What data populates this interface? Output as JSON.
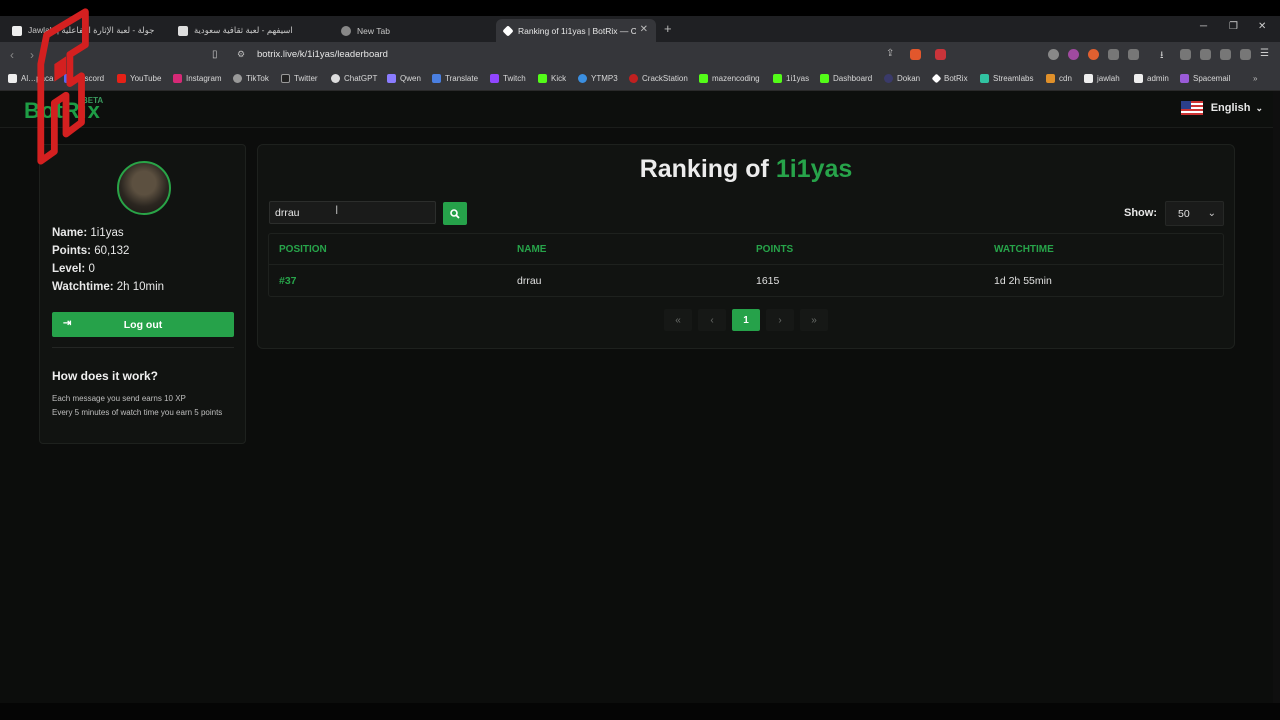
{
  "browser": {
    "tabs": [
      {
        "title": "Jawlah | جولة - لعبة الإثارة التفاعلية",
        "left": 0
      },
      {
        "title": "اسيفهم - لعبة ثقافية سعودية"
      },
      {
        "title": "New Tab"
      },
      {
        "title": "Ranking of 1i1yas | BotRix — Cl…",
        "active": true
      }
    ],
    "url": "botrix.live/k/1i1yas/leaderboard",
    "bookmarks": [
      "Al…paca",
      "Discord",
      "YouTube",
      "Instagram",
      "TikTok",
      "Twitter",
      "ChatGPT",
      "Qwen",
      "Translate",
      "Twitch",
      "Kick",
      "YTMP3",
      "CrackStation",
      "mazencoding",
      "1i1yas",
      "Dashboard",
      "Dokan",
      "BotRix",
      "Streamlabs",
      "cdn",
      "jawlah",
      "admin",
      "Spacemail"
    ]
  },
  "header": {
    "logo": "BotRix",
    "beta": "BETA",
    "language": "English"
  },
  "profile": {
    "name_label": "Name:",
    "name": "1i1yas",
    "points_label": "Points:",
    "points": "60,132",
    "level_label": "Level:",
    "level": "0",
    "watchtime_label": "Watchtime:",
    "watchtime": "2h 10min",
    "logout": "Log out",
    "how_title": "How does it work?",
    "how_line1": "Each message you send earns 10 XP",
    "how_line2": "Every 5 minutes of watch time you earn 5 points"
  },
  "leaderboard": {
    "title_prefix": "Ranking of",
    "title_user": "1i1yas",
    "search_value": "drrau",
    "show_label": "Show:",
    "show_value": "50",
    "columns": [
      "POSITION",
      "NAME",
      "POINTS",
      "WATCHTIME"
    ],
    "rows": [
      {
        "position": "#37",
        "name": "drrau",
        "points": "1615",
        "watchtime": "1d 2h 55min"
      }
    ],
    "pagination": {
      "first": "«",
      "prev": "‹",
      "current": "1",
      "next": "›",
      "last": "»"
    }
  },
  "colors": {
    "accent": "#27a44a",
    "background": "#0c0d0c",
    "watermark": "#d42020"
  }
}
